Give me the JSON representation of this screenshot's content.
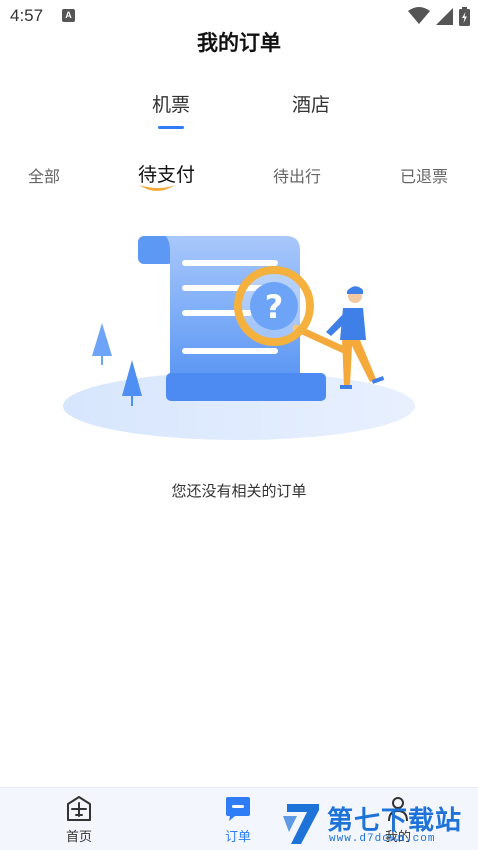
{
  "status_bar": {
    "time": "4:57",
    "notification_badge": "A",
    "icons": [
      "wifi-icon",
      "signal-icon",
      "battery-icon"
    ]
  },
  "header": {
    "title": "我的订单"
  },
  "main_tabs": [
    {
      "label": "机票",
      "active": true
    },
    {
      "label": "酒店",
      "active": false
    }
  ],
  "sub_tabs": [
    {
      "label": "全部",
      "active": false
    },
    {
      "label": "待支付",
      "active": true
    },
    {
      "label": "待出行",
      "active": false
    },
    {
      "label": "已退票",
      "active": false
    }
  ],
  "empty_state": {
    "message": "您还没有相关的订单",
    "illustration": "empty-orders-illustration"
  },
  "bottom_nav": [
    {
      "label": "首页",
      "icon": "airplane-icon",
      "active": false
    },
    {
      "label": "订单",
      "icon": "order-list-icon",
      "active": true
    },
    {
      "label": "我的",
      "icon": "person-icon",
      "active": false
    }
  ],
  "watermark": {
    "title": "第七下载站",
    "url": "www.d7down.com"
  },
  "colors": {
    "accent": "#2f7df6",
    "accent_orange": "#f4a93a",
    "nav_background": "#f3f6fd"
  }
}
